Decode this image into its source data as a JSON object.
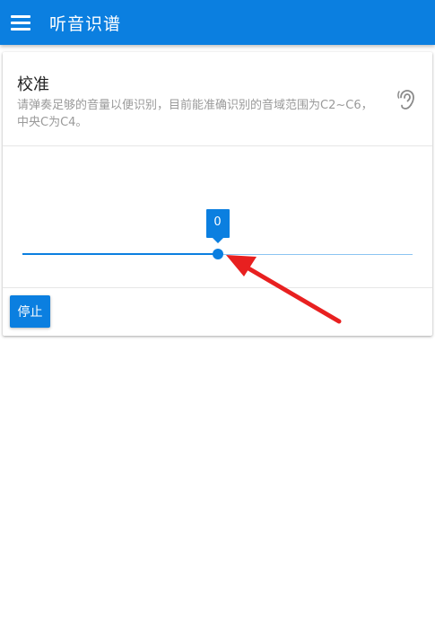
{
  "appbar": {
    "title": "听音识谱",
    "color": "#0b7fe0"
  },
  "card": {
    "title": "校准",
    "description": "请弹奏足够的音量以便识别，目前能准确识别的音域范围为C2~C6，中央C为C4。",
    "icon": "ear-icon"
  },
  "slider": {
    "value_label": "0",
    "fraction": 0.5
  },
  "stop_button": {
    "label": "停止"
  },
  "annotation": {
    "color": "#e82020"
  }
}
